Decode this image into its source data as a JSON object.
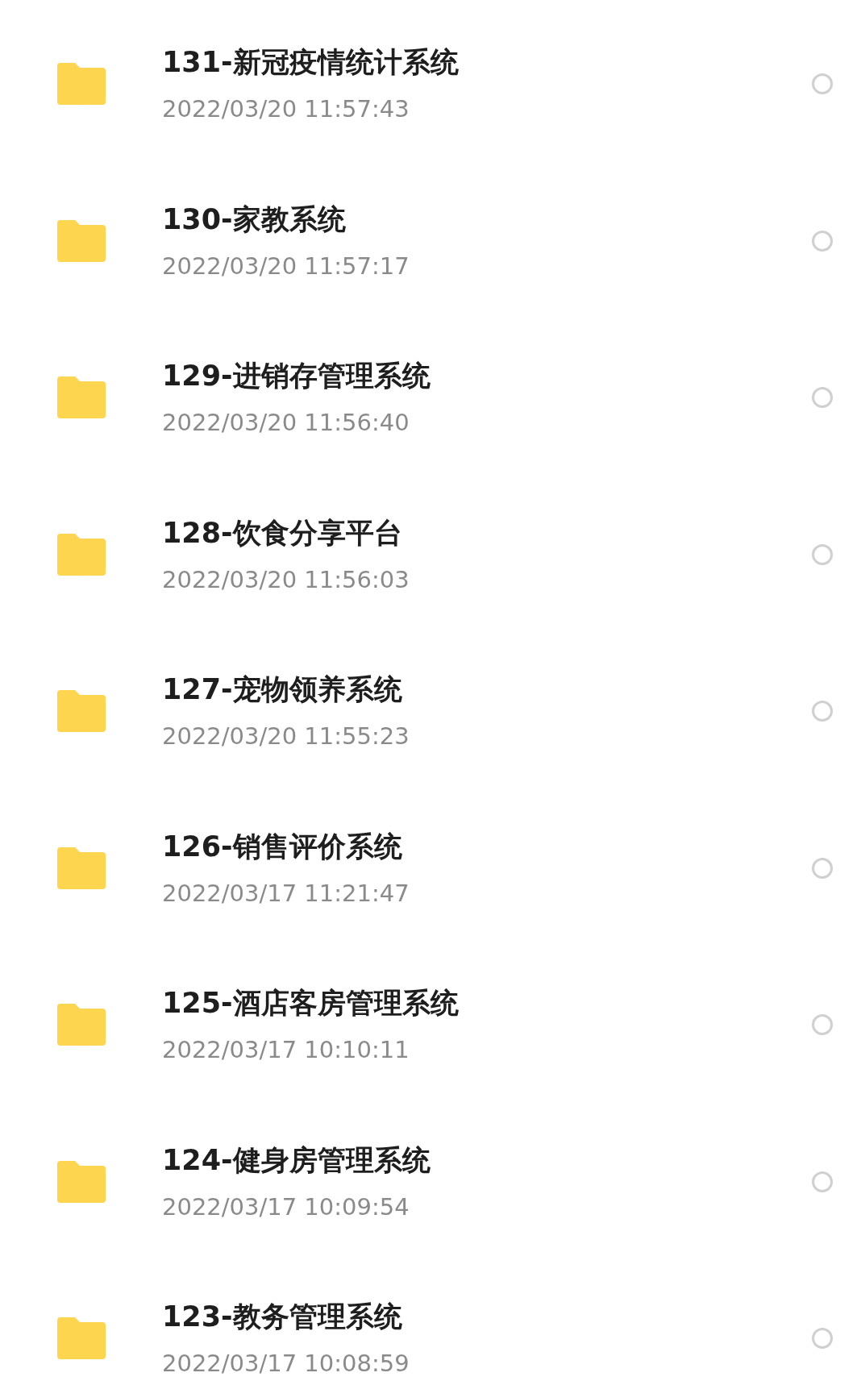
{
  "files": [
    {
      "name": "131-新冠疫情统计系统",
      "date": "2022/03/20 11:57:43",
      "selected": false
    },
    {
      "name": "130-家教系统",
      "date": "2022/03/20 11:57:17",
      "selected": false
    },
    {
      "name": "129-进销存管理系统",
      "date": "2022/03/20 11:56:40",
      "selected": false
    },
    {
      "name": "128-饮食分享平台",
      "date": "2022/03/20 11:56:03",
      "selected": false
    },
    {
      "name": "127-宠物领养系统",
      "date": "2022/03/20 11:55:23",
      "selected": false
    },
    {
      "name": "126-销售评价系统",
      "date": "2022/03/17 11:21:47",
      "selected": false
    },
    {
      "name": "125-酒店客房管理系统",
      "date": "2022/03/17 10:10:11",
      "selected": false
    },
    {
      "name": "124-健身房管理系统",
      "date": "2022/03/17 10:09:54",
      "selected": false
    },
    {
      "name": "123-教务管理系统",
      "date": "2022/03/17 10:08:59",
      "selected": false
    }
  ]
}
